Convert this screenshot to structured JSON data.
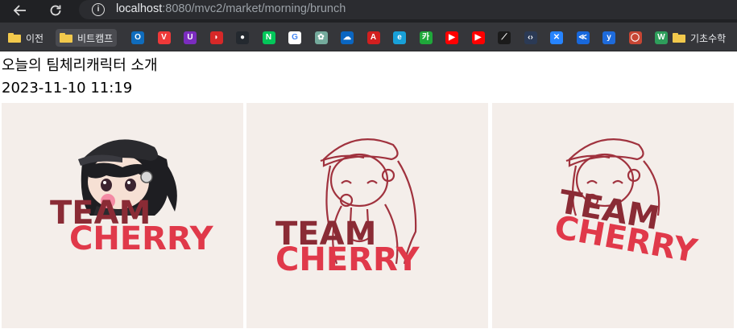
{
  "browser": {
    "url_host": "localhost",
    "url_path": ":8080/mvc2/market/morning/brunch",
    "bookmarks": [
      {
        "label": "이전"
      },
      {
        "label": "비트캠프"
      },
      {
        "label": "기초수학"
      }
    ],
    "favicons": [
      {
        "name": "outlook-icon",
        "color": "#0f6cbd",
        "glyph": "O"
      },
      {
        "name": "vivaldi-icon",
        "color": "#ef3939",
        "glyph": "V"
      },
      {
        "name": "u-app-icon",
        "color": "#7b2cbf",
        "glyph": "U"
      },
      {
        "name": "magnet-icon",
        "color": "#d62828",
        "glyph": "◗"
      },
      {
        "name": "github-icon",
        "color": "#24292f",
        "glyph": "●"
      },
      {
        "name": "naver-icon",
        "color": "#03c75a",
        "glyph": "N"
      },
      {
        "name": "google-icon",
        "color": "#ffffff",
        "glyph": "G"
      },
      {
        "name": "chatgpt-icon",
        "color": "#74aa9c",
        "glyph": "✿"
      },
      {
        "name": "onedrive-icon",
        "color": "#0a66c2",
        "glyph": "☁"
      },
      {
        "name": "acrobat-icon",
        "color": "#d21f1f",
        "glyph": "A"
      },
      {
        "name": "edge-icon",
        "color": "#18a0d8",
        "glyph": "e"
      },
      {
        "name": "kakao-icon",
        "color": "#1fa83a",
        "glyph": "카"
      },
      {
        "name": "youtube-icon",
        "color": "#ff0000",
        "glyph": "▶"
      },
      {
        "name": "youtube-icon-2",
        "color": "#ff0000",
        "glyph": "▶"
      },
      {
        "name": "chart-icon",
        "color": "#1b1b1b",
        "glyph": "⟋"
      },
      {
        "name": "code-icon",
        "color": "#2b3a55",
        "glyph": "‹›"
      },
      {
        "name": "jira-icon",
        "color": "#2684ff",
        "glyph": "✕"
      },
      {
        "name": "confluence-icon",
        "color": "#1868db",
        "glyph": "≪"
      },
      {
        "name": "yes-icon",
        "color": "#1e6bdb",
        "glyph": "y"
      },
      {
        "name": "oracle-icon",
        "color": "#c74634",
        "glyph": "◯"
      },
      {
        "name": "w-icon",
        "color": "#2e9e5b",
        "glyph": "W"
      }
    ]
  },
  "page": {
    "title": "오늘의 팀체리캐릭터 소개",
    "date": "2023-11-10 11:19"
  },
  "cards": [
    {
      "logo_line1": "TEAM",
      "logo_line2": "CHERRY",
      "style": "full-color"
    },
    {
      "logo_line1": "TEAM",
      "logo_line2": "CHERRY",
      "style": "line-art"
    },
    {
      "logo_line1": "TEAM",
      "logo_line2": "CHERRY",
      "style": "line-art-tilted"
    }
  ],
  "colors": {
    "logo_dark": "#8a2b35",
    "logo_red": "#e0394a",
    "card_bg": "#f4eeea"
  }
}
